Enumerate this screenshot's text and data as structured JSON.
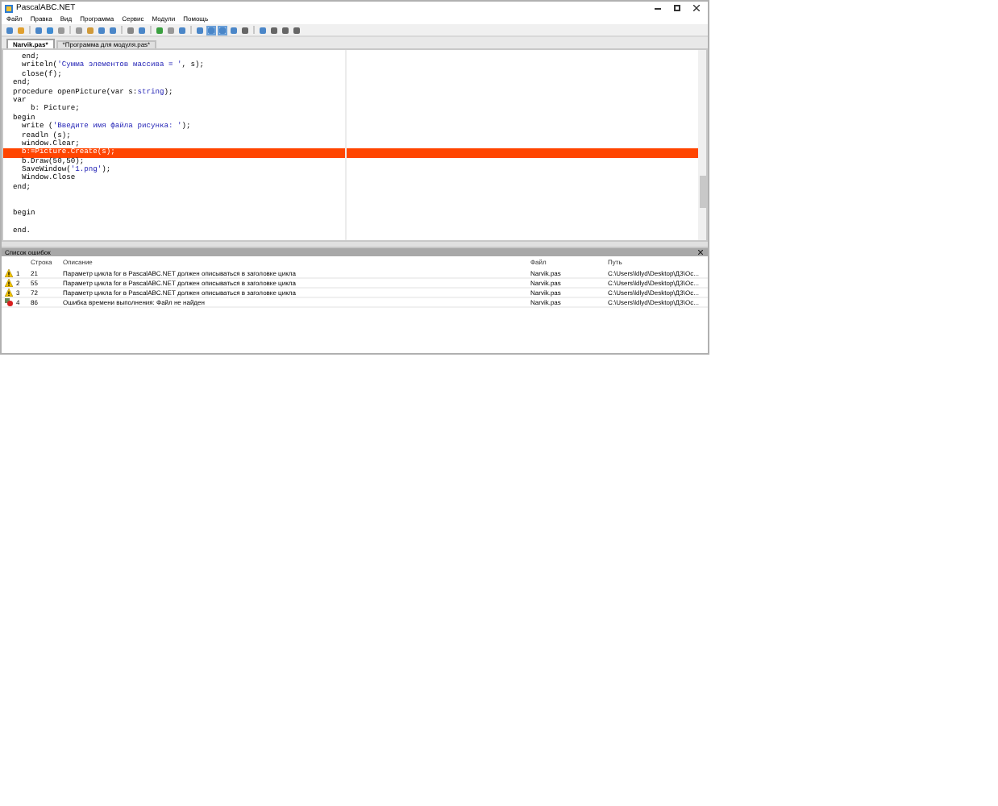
{
  "window": {
    "title": "PascalABC.NET"
  },
  "menu": [
    "Файл",
    "Правка",
    "Вид",
    "Программа",
    "Сервис",
    "Модули",
    "Помощь"
  ],
  "tabs": [
    {
      "label": "Narvik.pas*",
      "selected": true
    },
    {
      "label": "*Программа для модуля.pas*",
      "selected": false
    }
  ],
  "editor": {
    "lines": [
      {
        "highlighted": false,
        "parts": [
          {
            "kind": "code",
            "text": "  end;"
          }
        ]
      },
      {
        "highlighted": false,
        "parts": [
          {
            "kind": "code",
            "text": "  writeln("
          },
          {
            "kind": "string",
            "text": "'Сумма элементов массива = '"
          },
          {
            "kind": "code",
            "text": ", s);"
          }
        ]
      },
      {
        "highlighted": false,
        "parts": [
          {
            "kind": "code",
            "text": "  close(f);"
          }
        ]
      },
      {
        "highlighted": false,
        "parts": [
          {
            "kind": "code",
            "text": "end;"
          }
        ]
      },
      {
        "highlighted": false,
        "parts": [
          {
            "kind": "code",
            "text": "procedure openPicture(var s:"
          },
          {
            "kind": "string",
            "text": "string"
          },
          {
            "kind": "code",
            "text": ");"
          }
        ]
      },
      {
        "highlighted": false,
        "parts": [
          {
            "kind": "code",
            "text": "var"
          }
        ]
      },
      {
        "highlighted": false,
        "parts": [
          {
            "kind": "code",
            "text": "    b: Picture;"
          }
        ]
      },
      {
        "highlighted": false,
        "parts": [
          {
            "kind": "code",
            "text": "begin"
          }
        ]
      },
      {
        "highlighted": false,
        "parts": [
          {
            "kind": "code",
            "text": "  write ("
          },
          {
            "kind": "string",
            "text": "'Введите имя файла рисунка: '"
          },
          {
            "kind": "code",
            "text": ");"
          }
        ]
      },
      {
        "highlighted": false,
        "parts": [
          {
            "kind": "code",
            "text": "  readln (s);"
          }
        ]
      },
      {
        "highlighted": false,
        "parts": [
          {
            "kind": "code",
            "text": "  window.Clear;"
          }
        ]
      },
      {
        "highlighted": true,
        "parts": [
          {
            "kind": "code",
            "text": "  b:=Picture.Create(s);"
          }
        ]
      },
      {
        "highlighted": false,
        "parts": [
          {
            "kind": "code",
            "text": "  b.Draw(50,50);"
          }
        ]
      },
      {
        "highlighted": false,
        "parts": [
          {
            "kind": "code",
            "text": "  SaveWindow("
          },
          {
            "kind": "string",
            "text": "'1.png'"
          },
          {
            "kind": "code",
            "text": ");"
          }
        ]
      },
      {
        "highlighted": false,
        "parts": [
          {
            "kind": "code",
            "text": "  Window.Close"
          }
        ]
      },
      {
        "highlighted": false,
        "parts": [
          {
            "kind": "code",
            "text": "end;"
          }
        ]
      },
      {
        "highlighted": false
      },
      {
        "highlighted": false
      },
      {
        "highlighted": false,
        "parts": [
          {
            "kind": "code",
            "text": "begin"
          }
        ]
      },
      {
        "highlighted": false
      },
      {
        "highlighted": false,
        "parts": [
          {
            "kind": "code",
            "text": "end."
          }
        ]
      }
    ]
  },
  "error_list": {
    "title": "Список ошибок",
    "columns": [
      "Строка",
      "Описание",
      "Файл",
      "Путь"
    ],
    "rows": [
      {
        "kind": "warning",
        "number": "1",
        "line": "21",
        "description": "Параметр цикла for в PascalABC.NET должен описываться в заголовке цикла",
        "file": "Narvik.pas",
        "path": "C:\\Users\\ldlyd\\Desktop\\ДЗ\\Ос..."
      },
      {
        "kind": "warning",
        "number": "2",
        "line": "55",
        "description": "Параметр цикла for в PascalABC.NET должен описываться в заголовке цикла",
        "file": "Narvik.pas",
        "path": "C:\\Users\\ldlyd\\Desktop\\ДЗ\\Ос..."
      },
      {
        "kind": "warning",
        "number": "3",
        "line": "72",
        "description": "Параметр цикла for в PascalABC.NET должен описываться в заголовке цикла",
        "file": "Narvik.pas",
        "path": "C:\\Users\\ldlyd\\Desktop\\ДЗ\\Ос..."
      },
      {
        "kind": "error",
        "number": "4",
        "line": "86",
        "description": "Ошибка времени выполнения: Файл  не найден",
        "file": "Narvik.pas",
        "path": "C:\\Users\\ldlyd\\Desktop\\ДЗ\\Ос..."
      }
    ]
  }
}
